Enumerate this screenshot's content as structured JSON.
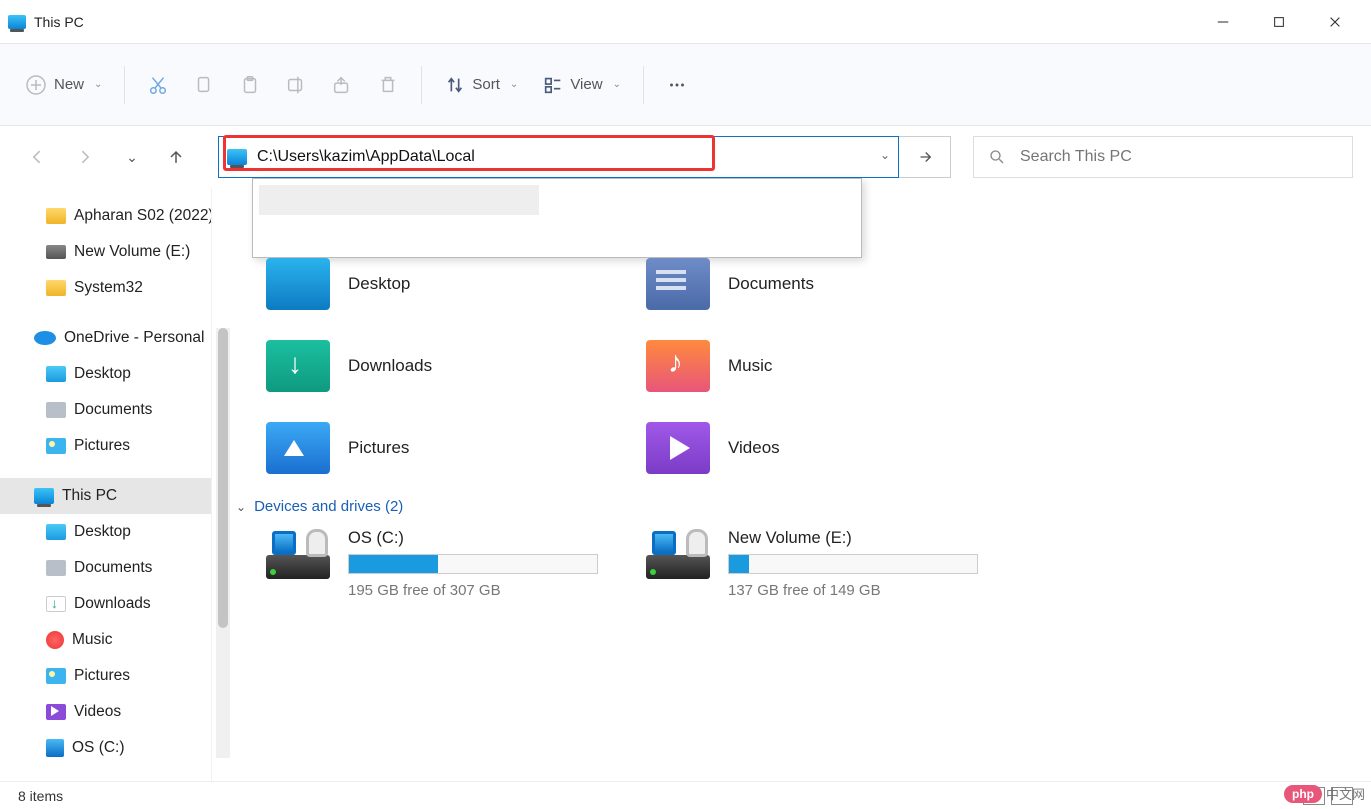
{
  "window": {
    "title": "This PC"
  },
  "toolbar": {
    "new_label": "New",
    "sort_label": "Sort",
    "view_label": "View"
  },
  "address": {
    "path": "C:\\Users\\kazim\\AppData\\Local"
  },
  "search": {
    "placeholder": "Search This PC"
  },
  "sidebar": {
    "items": [
      {
        "label": "Apharan S02 (2022)",
        "icon": "i-folder-y",
        "indent": "sub"
      },
      {
        "label": "New Volume (E:)",
        "icon": "i-disk",
        "indent": "sub"
      },
      {
        "label": "System32",
        "icon": "i-folder-y",
        "indent": "sub"
      },
      {
        "label": "OneDrive - Personal",
        "icon": "i-onedrive",
        "indent": "top"
      },
      {
        "label": "Desktop",
        "icon": "i-desktop",
        "indent": "sub"
      },
      {
        "label": "Documents",
        "icon": "i-doc",
        "indent": "sub"
      },
      {
        "label": "Pictures",
        "icon": "i-pic",
        "indent": "sub"
      },
      {
        "label": "This PC",
        "icon": "i-pc",
        "indent": "top",
        "active": true
      },
      {
        "label": "Desktop",
        "icon": "i-desktop",
        "indent": "sub"
      },
      {
        "label": "Documents",
        "icon": "i-doc",
        "indent": "sub"
      },
      {
        "label": "Downloads",
        "icon": "i-dl",
        "indent": "sub"
      },
      {
        "label": "Music",
        "icon": "i-music",
        "indent": "sub"
      },
      {
        "label": "Pictures",
        "icon": "i-pic",
        "indent": "sub"
      },
      {
        "label": "Videos",
        "icon": "i-video",
        "indent": "sub"
      },
      {
        "label": "OS (C:)",
        "icon": "i-os",
        "indent": "sub"
      }
    ]
  },
  "content": {
    "section_devices": "Devices and drives (2)",
    "folders": [
      {
        "label": "Desktop",
        "icon": "fi-desktop"
      },
      {
        "label": "Documents",
        "icon": "fi-documents"
      },
      {
        "label": "Downloads",
        "icon": "fi-downloads"
      },
      {
        "label": "Music",
        "icon": "fi-music"
      },
      {
        "label": "Pictures",
        "icon": "fi-pictures"
      },
      {
        "label": "Videos",
        "icon": "fi-videos"
      }
    ],
    "drives": [
      {
        "name": "OS (C:)",
        "free": "195 GB free of 307 GB",
        "fill_pct": 36
      },
      {
        "name": "New Volume (E:)",
        "free": "137 GB free of 149 GB",
        "fill_pct": 8
      }
    ]
  },
  "status": {
    "text": "8 items"
  },
  "watermark": {
    "badge": "php",
    "text": "中文网"
  }
}
